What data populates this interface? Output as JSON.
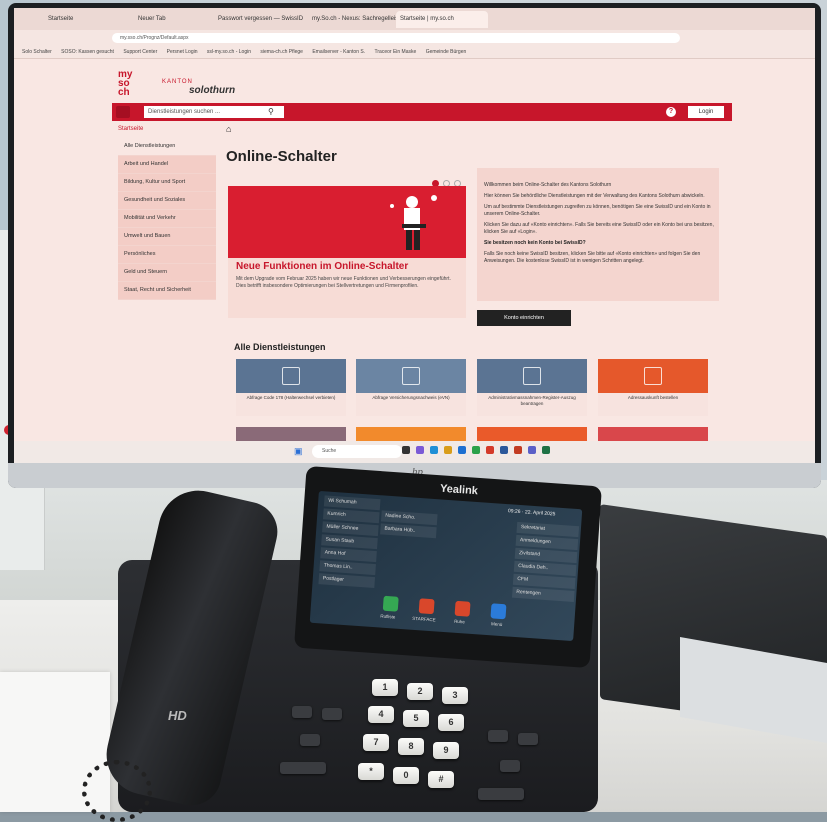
{
  "browser": {
    "tabs": [
      "Startseite",
      "Neuer Tab",
      "Passwort vergessen — SwissID",
      "my.So.ch - Nexus: Sachregelleistung",
      "Startseite | my.so.ch"
    ],
    "url": "my.sso.ch/Prognz/Default.aspx",
    "bookmarks": [
      "Solo Schalter",
      "SOSO: Kassen gesucht",
      "Support Center",
      "Persnet Login",
      "ssl-my.so.ch - Login",
      "siema-ch.ch Pflege",
      "Emailserver - Kanton S.",
      "Traceor Ein Maske",
      "Gemeinde Bürgen"
    ]
  },
  "site": {
    "logo_lines": [
      "my",
      "so",
      "ch"
    ],
    "kanton_label": "KANTON",
    "kanton_name": "solothurn",
    "search_placeholder": "Dienstleistungen suchen ...",
    "help_label": "?",
    "login_label": "Login",
    "breadcrumb": "Startseite",
    "page_title": "Online-Schalter",
    "sidebar": [
      "Alle Dienstleistungen",
      "Arbeit und Handel",
      "Bildung, Kultur und Sport",
      "Gesundheit und Soziales",
      "Mobilität und Verkehr",
      "Umwelt und Bauen",
      "Persönliches",
      "Geld und Steuern",
      "Staat, Recht und Sicherheit"
    ],
    "news_title": "Neue Funktionen im Online-Schalter",
    "news_text": "Mit dem Upgrade vom Februar 2025 haben wir neue Funktionen und Verbesserungen eingeführt. Dies betrifft insbesondere Optimierungen bei Stellvertretungen und Firmenprofilen.",
    "info": [
      "Willkommen beim Online-Schalter des Kantons Solothurn",
      "Hier können Sie behördliche Dienstleistungen mit der Verwaltung des Kantons Solothurn abwickeln.",
      "Um auf bestimmte Dienstleistungen zugreifen zu können, benötigen Sie eine SwissID und ein Konto in unserem Online-Schalter.",
      "Klicken Sie dazu auf «Konto einrichten». Falls Sie bereits eine SwissID oder ein Konto bei uns besitzen, klicken Sie auf «Login».",
      "Sie besitzen noch kein Konto bei SwissID?",
      "Falls Sie noch keine SwissID besitzen, klicken Sie bitte auf «Konto einrichten» und folgen Sie den Anweisungen. Die kostenlose SwissID ist in wenigen Schritten angelegt."
    ],
    "konto_button": "Konto einrichten",
    "services_heading": "Alle Dienstleistungen",
    "services": [
      {
        "label": "Abfrage Code 178 (Halterwechsel verbieten)",
        "color": "#5b7493"
      },
      {
        "label": "Abfrage Versicherungsnachweis (eVN)",
        "color": "#6b85a3"
      },
      {
        "label": "Administrativmassnahmen-Register-Auszug beantragen",
        "color": "#5b7493"
      },
      {
        "label": "Adressauskunft bestellen",
        "color": "#e5582b"
      }
    ],
    "taskbar_search": "Suche"
  },
  "phone": {
    "brand": "Yealink",
    "hd_label": "HD",
    "time": "09:26 · 22. April 2025",
    "line_keys_left": [
      "Wi Schumah",
      "Kumrich",
      "Müller Schnee",
      "Susan Staub",
      "Anna Hof",
      "Thomas Lin..",
      "Postlager"
    ],
    "line_keys_mid": [
      "Nadine Scho.",
      "Barbara Hüb.."
    ],
    "line_keys_right": [
      "Sekretariat",
      "Anmeldungen",
      "Zivilstand",
      "Claudia Deh..",
      "CFM",
      "Rentengen"
    ],
    "softkeys": [
      "Rufliste",
      "STARFACE",
      "Ruhe",
      "Menü"
    ],
    "keypad": [
      "1",
      "2",
      "3",
      "4",
      "5",
      "6",
      "7",
      "8",
      "9",
      "*",
      "0",
      "#"
    ]
  }
}
